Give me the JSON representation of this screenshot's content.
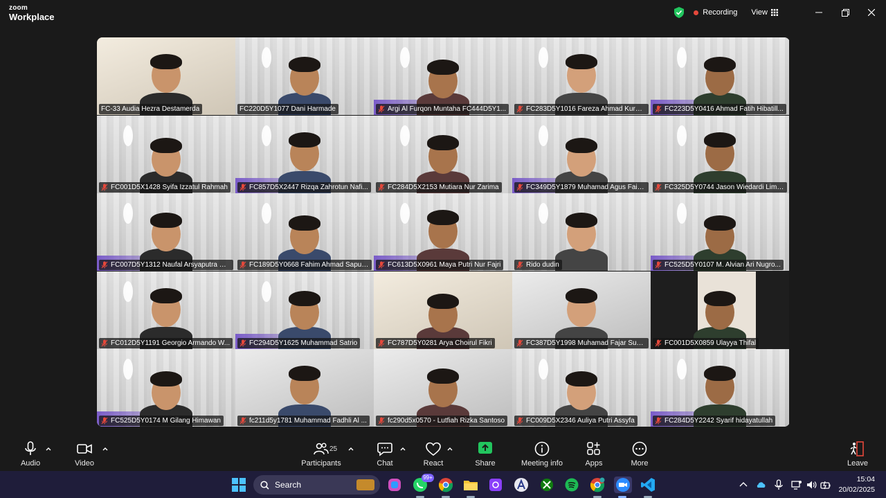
{
  "app": {
    "brand_top": "zoom",
    "brand_bottom": "Workplace"
  },
  "titlebar": {
    "recording_label": "Recording",
    "view_label": "View"
  },
  "colors": {
    "active_speaker": "#22c55e",
    "record_dot": "#e5483b",
    "muted_icon": "#e5483b",
    "share_green": "#22c55e"
  },
  "participants": [
    {
      "name": "FC-33 Audia Hezra Destamerda",
      "muted": false,
      "bg": "real"
    },
    {
      "name": "FC220D5Y1077 Dani Harmade",
      "muted": false,
      "bg": "virtual",
      "active": true
    },
    {
      "name": "Argi Al Furqon Muntaha FC444D5Y1...",
      "muted": true,
      "bg": "virtual"
    },
    {
      "name": "FC283D5Y1016 Fareza Ahmad Kurni...",
      "muted": true,
      "bg": "virtual"
    },
    {
      "name": "FC223D5Y0416 Ahmad Fatih Hibatill...",
      "muted": true,
      "bg": "virtual"
    },
    {
      "name": "FC001D5X1428 Syifa Izzatul Rahmah",
      "muted": true,
      "bg": "virtual"
    },
    {
      "name": "FC857D5X2447 Rizqa Zahrotun Nafi...",
      "muted": true,
      "bg": "virtual"
    },
    {
      "name": "FC284D5X2153 Mutiara Nur Zarima",
      "muted": true,
      "bg": "virtual"
    },
    {
      "name": "FC349D5Y1879 Muhamad Agus Faisal",
      "muted": true,
      "bg": "virtual"
    },
    {
      "name": "FC325D5Y0744 Jason Wiedardi Limt...",
      "muted": true,
      "bg": "virtual"
    },
    {
      "name": "FC007D5Y1312 Naufal Arsyaputra Pr...",
      "muted": true,
      "bg": "virtual"
    },
    {
      "name": "FC189D5Y0668 Fahim Ahmad Saputra",
      "muted": true,
      "bg": "virtual"
    },
    {
      "name": "FC613D5X0961 Maya Putri Nur Fajri",
      "muted": true,
      "bg": "virtual"
    },
    {
      "name": "Rido dudin",
      "muted": true,
      "bg": "virtual"
    },
    {
      "name": "FC525D5Y0107 M. Alvian Ari Nugro...",
      "muted": true,
      "bg": "virtual"
    },
    {
      "name": "FC012D5Y1191 Georgio Armando W...",
      "muted": true,
      "bg": "virtual"
    },
    {
      "name": "FC294D5Y1625 Muhammad Satrio",
      "muted": true,
      "bg": "virtual"
    },
    {
      "name": "FC787D5Y0281 Arya Choirul Fikri",
      "muted": true,
      "bg": "real"
    },
    {
      "name": "FC387D5Y1998 Muhamad Fajar Supr...",
      "muted": true,
      "bg": "wall"
    },
    {
      "name": "FC001D5X0859 Ulayya Thifal",
      "muted": true,
      "bg": "black"
    },
    {
      "name": "FC525D5Y0174 M Gilang Himawan",
      "muted": true,
      "bg": "virtual"
    },
    {
      "name": "fc211d5y1781 Muhammad Fadhli Al ...",
      "muted": true,
      "bg": "wall"
    },
    {
      "name": "fc290d5x0570 - Lutfiah Rizka Santoso",
      "muted": true,
      "bg": "wall"
    },
    {
      "name": "FC009D5X2346 Auliya Putri Assyfa",
      "muted": true,
      "bg": "virtual"
    },
    {
      "name": "FC284D5Y2242 Syarif hidayatullah",
      "muted": true,
      "bg": "virtual"
    }
  ],
  "toolbar": {
    "audio": "Audio",
    "video": "Video",
    "participants": "Participants",
    "participant_count": "25",
    "chat": "Chat",
    "react": "React",
    "share": "Share",
    "meeting_info": "Meeting info",
    "apps": "Apps",
    "more": "More",
    "leave": "Leave"
  },
  "taskbar": {
    "search_label": "Search",
    "whatsapp_badge": "99+",
    "time": "15:04",
    "date": "20/02/2025"
  }
}
